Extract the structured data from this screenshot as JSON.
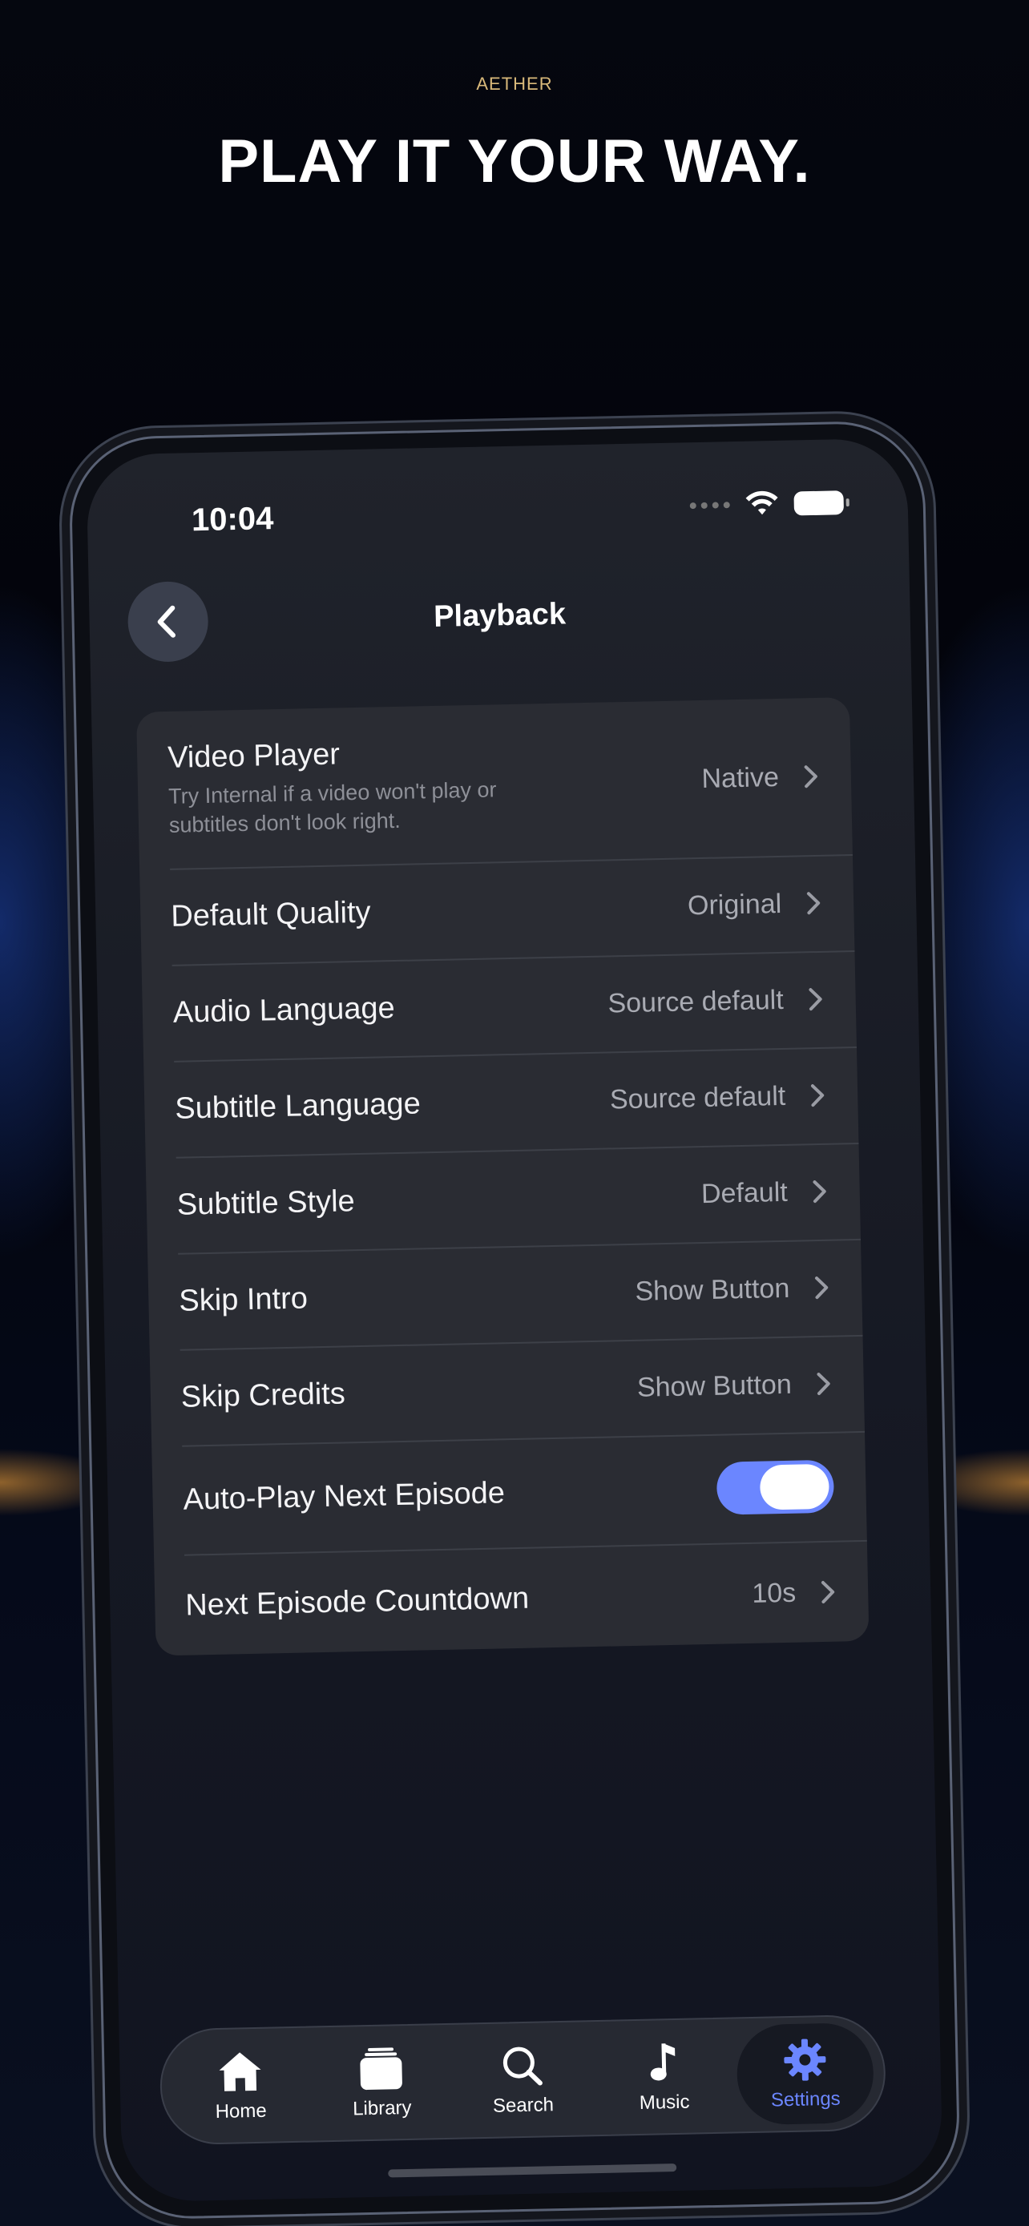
{
  "brand": "AETHER",
  "headline": "PLAY IT YOUR WAY.",
  "status": {
    "time": "10:04"
  },
  "nav": {
    "title": "Playback"
  },
  "settings": {
    "video_player": {
      "label": "Video Player",
      "subtitle": "Try Internal if a video won't play or subtitles don't look right.",
      "value": "Native"
    },
    "default_quality": {
      "label": "Default Quality",
      "value": "Original"
    },
    "audio_language": {
      "label": "Audio Language",
      "value": "Source default"
    },
    "subtitle_language": {
      "label": "Subtitle Language",
      "value": "Source default"
    },
    "subtitle_style": {
      "label": "Subtitle Style",
      "value": "Default"
    },
    "skip_intro": {
      "label": "Skip Intro",
      "value": "Show Button"
    },
    "skip_credits": {
      "label": "Skip Credits",
      "value": "Show Button"
    },
    "autoplay_next": {
      "label": "Auto-Play Next Episode",
      "enabled": true
    },
    "next_countdown": {
      "label": "Next Episode Countdown",
      "value": "10s"
    }
  },
  "tabs": [
    {
      "label": "Home",
      "icon": "home-icon"
    },
    {
      "label": "Library",
      "icon": "library-icon"
    },
    {
      "label": "Search",
      "icon": "search-icon"
    },
    {
      "label": "Music",
      "icon": "music-note-icon"
    },
    {
      "label": "Settings",
      "icon": "gear-icon",
      "active": true
    }
  ],
  "colors": {
    "accent": "#6b86ff",
    "brand": "#d9b97a",
    "card": "#2a2c33"
  }
}
